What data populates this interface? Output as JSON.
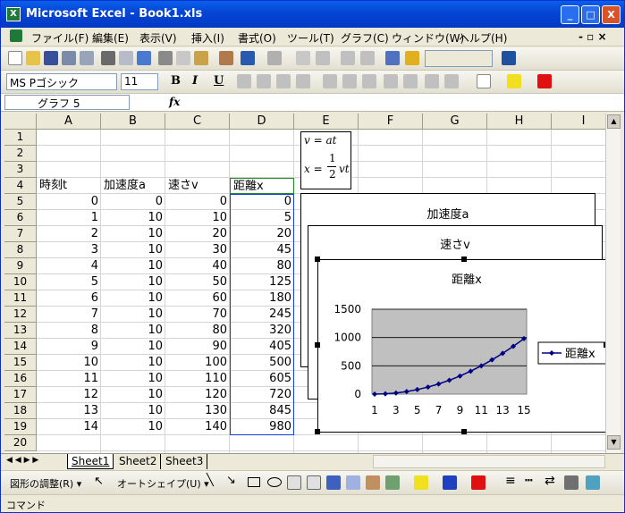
{
  "window": {
    "title": "Microsoft Excel - Book1.xls",
    "minimize_label": "_",
    "maximize_label": "□",
    "close_label": "X"
  },
  "menu": {
    "items": [
      "ファイル(F)",
      "編集(E)",
      "表示(V)",
      "挿入(I)",
      "書式(O)",
      "ツール(T)",
      "グラフ(C)",
      "ウィンドウ(W)",
      "ヘルプ(H)"
    ],
    "doc_controls": "- ▫ ×"
  },
  "format_toolbar": {
    "font_name": "MS Pゴシック",
    "font_size": "11",
    "bold": "B",
    "italic": "I",
    "underline": "U"
  },
  "formula_bar": {
    "name_box": "グラフ 5",
    "fx": "fx",
    "formula": ""
  },
  "columns": [
    "A",
    "B",
    "C",
    "D",
    "E",
    "F",
    "G",
    "H",
    "I"
  ],
  "rows": [
    "1",
    "2",
    "3",
    "4",
    "5",
    "6",
    "7",
    "8",
    "9",
    "10",
    "11",
    "12",
    "13",
    "14",
    "15",
    "16",
    "17",
    "18",
    "19",
    "20"
  ],
  "headers": {
    "a4": "時刻t",
    "b4": "加速度a",
    "c4": "速さv",
    "d4": "距離x"
  },
  "table": {
    "t": [
      "0",
      "1",
      "2",
      "3",
      "4",
      "5",
      "6",
      "7",
      "8",
      "9",
      "10",
      "11",
      "12",
      "13",
      "14"
    ],
    "a": [
      "0",
      "10",
      "10",
      "10",
      "10",
      "10",
      "10",
      "10",
      "10",
      "10",
      "10",
      "10",
      "10",
      "10",
      "10"
    ],
    "v": [
      "0",
      "10",
      "20",
      "30",
      "40",
      "50",
      "60",
      "70",
      "80",
      "90",
      "100",
      "110",
      "120",
      "130",
      "140"
    ],
    "x": [
      "0",
      "5",
      "20",
      "45",
      "80",
      "125",
      "180",
      "245",
      "320",
      "405",
      "500",
      "605",
      "720",
      "845",
      "980"
    ]
  },
  "formula_box": {
    "line1": "v = at",
    "line2_lhs": "x =",
    "line2_num": "1",
    "line2_den": "2",
    "line2_rhs": "vt"
  },
  "back_charts": {
    "chart1_title": "加速度a",
    "chart2_title": "速さv"
  },
  "chart_data": {
    "type": "line",
    "title": "距離x",
    "categories": [
      "1",
      "3",
      "5",
      "7",
      "9",
      "11",
      "13",
      "15"
    ],
    "x": [
      1,
      2,
      3,
      4,
      5,
      6,
      7,
      8,
      9,
      10,
      11,
      12,
      13,
      14,
      15
    ],
    "series": [
      {
        "name": "距離x",
        "values": [
          0,
          5,
          20,
          45,
          80,
          125,
          180,
          245,
          320,
          405,
          500,
          605,
          720,
          845,
          980
        ]
      }
    ],
    "yticks": [
      "0",
      "500",
      "1000",
      "1500"
    ],
    "ylim": [
      0,
      1500
    ],
    "grid": true,
    "legend": "right",
    "plot_color": "#c0c0c0",
    "line_color": "#000080"
  },
  "sheet_tabs": [
    "Sheet1",
    "Sheet2",
    "Sheet3"
  ],
  "drawing_toolbar": {
    "adjust": "図形の調整(R) ▾",
    "autoshape": "オートシェイプ(U) ▾"
  },
  "status": {
    "text": "コマンド"
  }
}
